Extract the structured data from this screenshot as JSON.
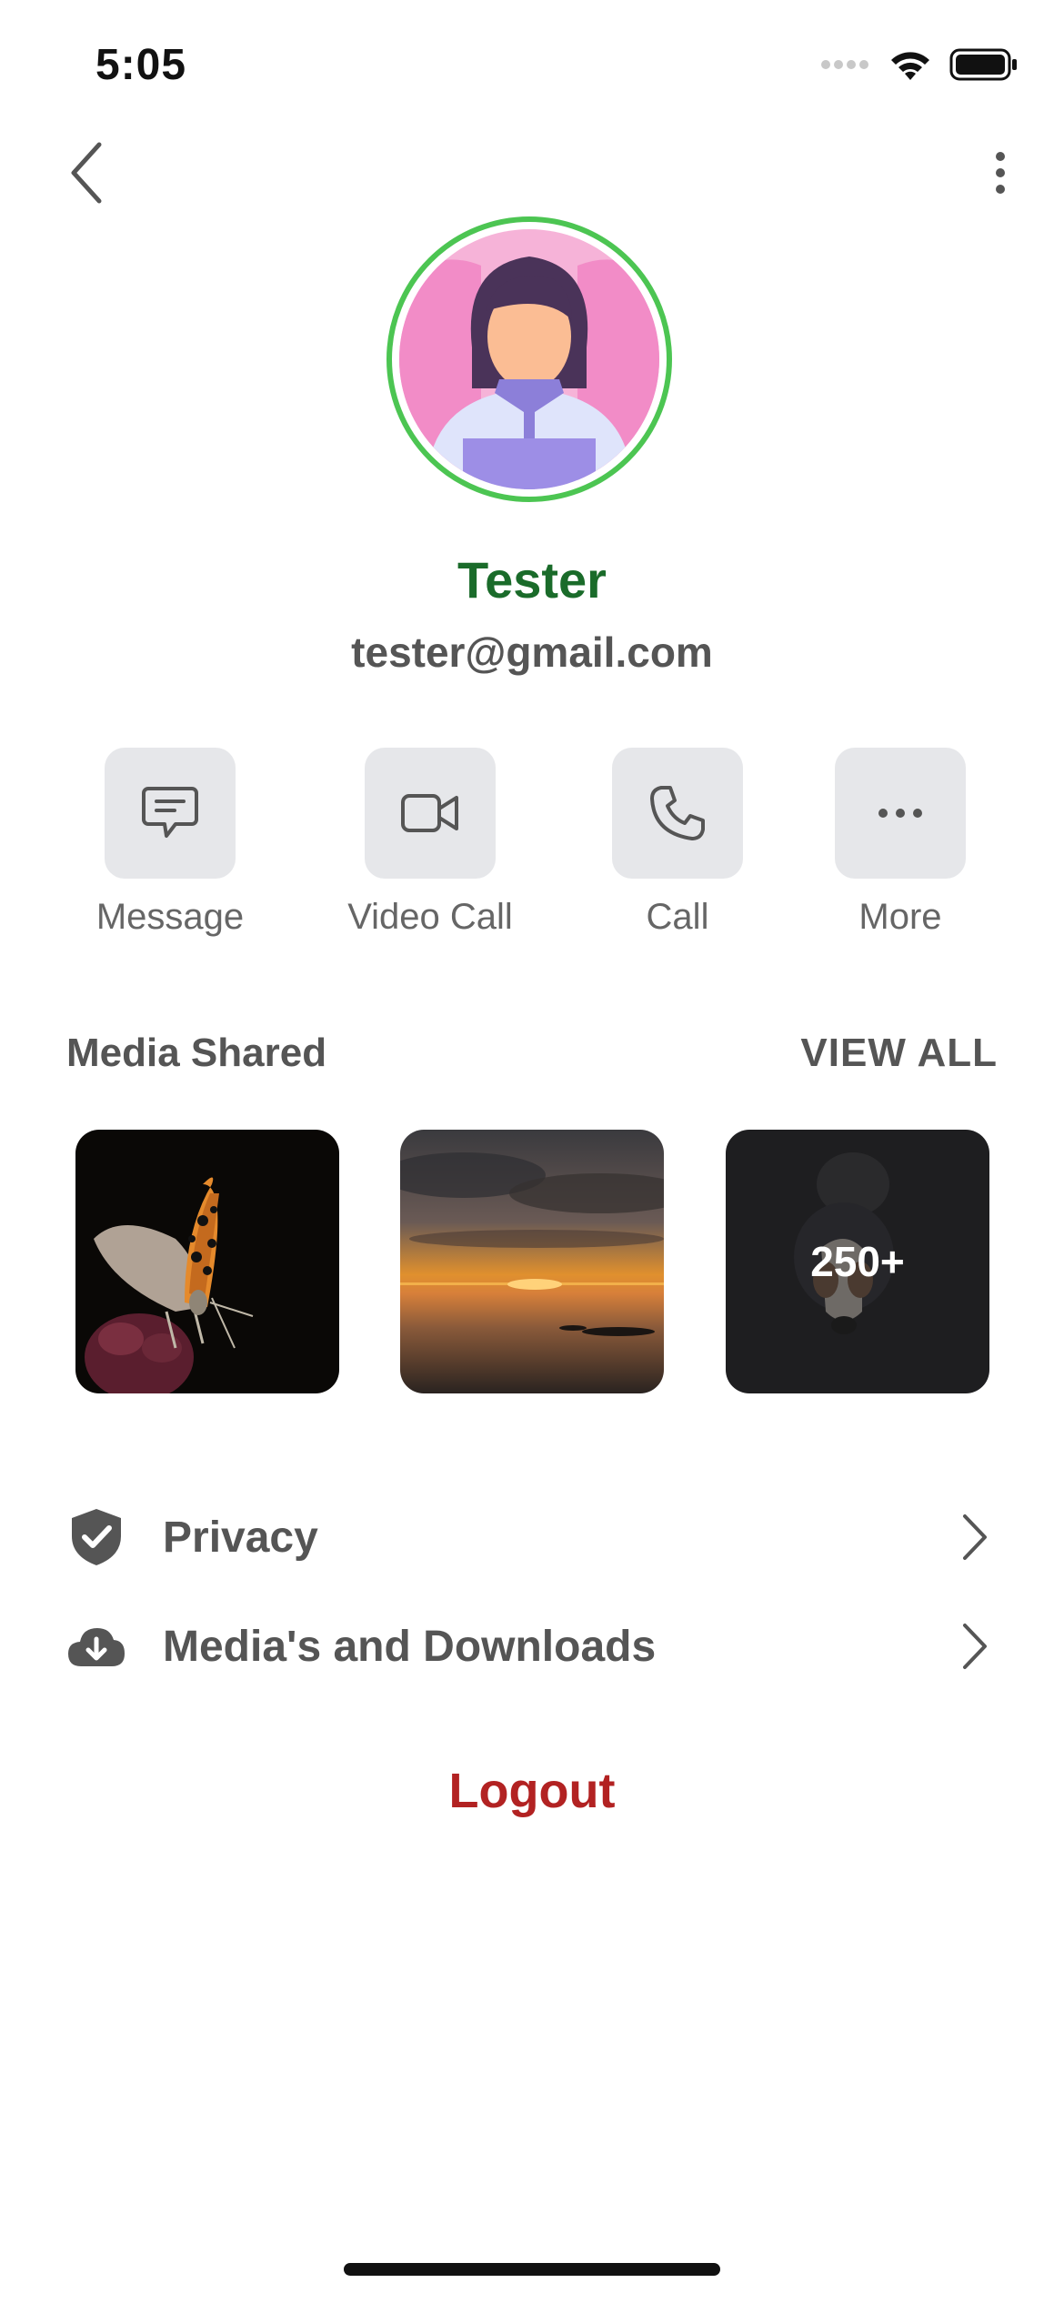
{
  "status": {
    "time": "5:05"
  },
  "profile": {
    "name": "Tester",
    "email": "tester@gmail.com"
  },
  "actions": [
    {
      "label": "Message",
      "icon": "message-icon"
    },
    {
      "label": "Video Call",
      "icon": "video-call-icon"
    },
    {
      "label": "Call",
      "icon": "phone-icon"
    },
    {
      "label": "More",
      "icon": "more-dots-icon"
    }
  ],
  "media": {
    "title": "Media Shared",
    "view_all": "VIEW ALL",
    "items": [
      {
        "name": "butterfly-photo"
      },
      {
        "name": "sunset-photo"
      },
      {
        "name": "dog-photo",
        "overlay": "250+"
      }
    ]
  },
  "menu": [
    {
      "label": "Privacy",
      "icon": "shield-check-icon"
    },
    {
      "label": "Media's and Downloads",
      "icon": "cloud-download-icon"
    }
  ],
  "logout": "Logout",
  "colors": {
    "name": "#1a6b2a",
    "ring": "#4cc552",
    "logout": "#b22222"
  }
}
